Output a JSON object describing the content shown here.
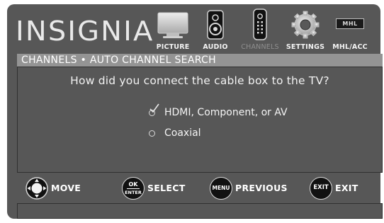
{
  "brand": {
    "logo_text": "INSIGNIA"
  },
  "tabs": [
    {
      "label": "PICTURE",
      "icon": "tv-icon",
      "active": false
    },
    {
      "label": "AUDIO",
      "icon": "speaker-icon",
      "active": false
    },
    {
      "label": "CHANNELS",
      "icon": "remote-icon",
      "active": true
    },
    {
      "label": "SETTINGS",
      "icon": "gear-icon",
      "active": false
    },
    {
      "label": "MHL/ACC",
      "icon": "mhl-icon",
      "badge_text": "MHL",
      "active": false
    }
  ],
  "breadcrumb": "CHANNELS • AUTO CHANNEL SEARCH",
  "question": "How did you connect the cable box to the TV?",
  "options": [
    {
      "label": "HDMI, Component, or AV",
      "selected": true
    },
    {
      "label": "Coaxial",
      "selected": false
    }
  ],
  "controls": [
    {
      "badge": "",
      "icon": "dpad-icon",
      "label": "MOVE"
    },
    {
      "badge_top": "OK",
      "badge_bottom": "ENTER",
      "icon": "ok-enter-icon",
      "label": "SELECT"
    },
    {
      "badge": "MENU",
      "icon": "menu-icon",
      "label": "PREVIOUS"
    },
    {
      "badge": "EXIT",
      "icon": "exit-icon",
      "label": "EXIT"
    }
  ],
  "colors": {
    "screen_bg": "#575757",
    "breadcrumb_bg": "#949494",
    "text": "#f2f2f2",
    "dim_label": "#8f8f8f"
  }
}
